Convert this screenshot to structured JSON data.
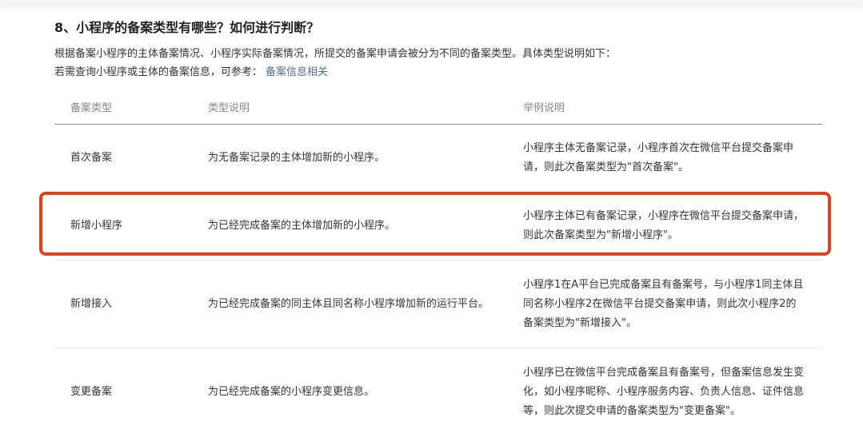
{
  "section": {
    "title": "8、小程序的备案类型有哪些？如何进行判断？",
    "intro": "根据备案小程序的主体备案情况、小程序实际备案情况，所提交的备案申请会被分为不同的备案类型。具体类型说明如下：",
    "ref_text": "若需查询小程序或主体的备案信息，可参考：",
    "ref_link": "备案信息相关"
  },
  "table": {
    "headers": [
      "备案类型",
      "类型说明",
      "举例说明"
    ],
    "rows": [
      {
        "type": "首次备案",
        "desc": "为无备案记录的主体增加新的小程序。",
        "example": "小程序主体无备案记录，小程序首次在微信平台提交备案申请，则此次备案类型为\"首次备案\"。"
      },
      {
        "type": "新增小程序",
        "desc": "为已经完成备案的主体增加新的小程序。",
        "example": "小程序主体已有备案记录，小程序在微信平台提交备案申请，则此次备案类型为\"新增小程序\"。"
      },
      {
        "type": "新增接入",
        "desc": "为已经完成备案的同主体且同名称小程序增加新的运行平台。",
        "example": "小程序1在A平台已完成备案且有备案号，与小程序1同主体且同名称小程序2在微信平台提交备案申请，则此次小程序2的备案类型为\"新增接入\"。"
      },
      {
        "type": "变更备案",
        "desc": "为已经完成备案的小程序变更信息。",
        "example": "小程序已在微信平台完成备案且有备案号，但备案信息发生变化，如小程序昵称、小程序服务内容、负责人信息、证件信息等，则此次提交申请的备案类型为\"变更备案\"。"
      }
    ]
  },
  "colors": {
    "highlight": "#d9431e",
    "link": "#576b95"
  }
}
